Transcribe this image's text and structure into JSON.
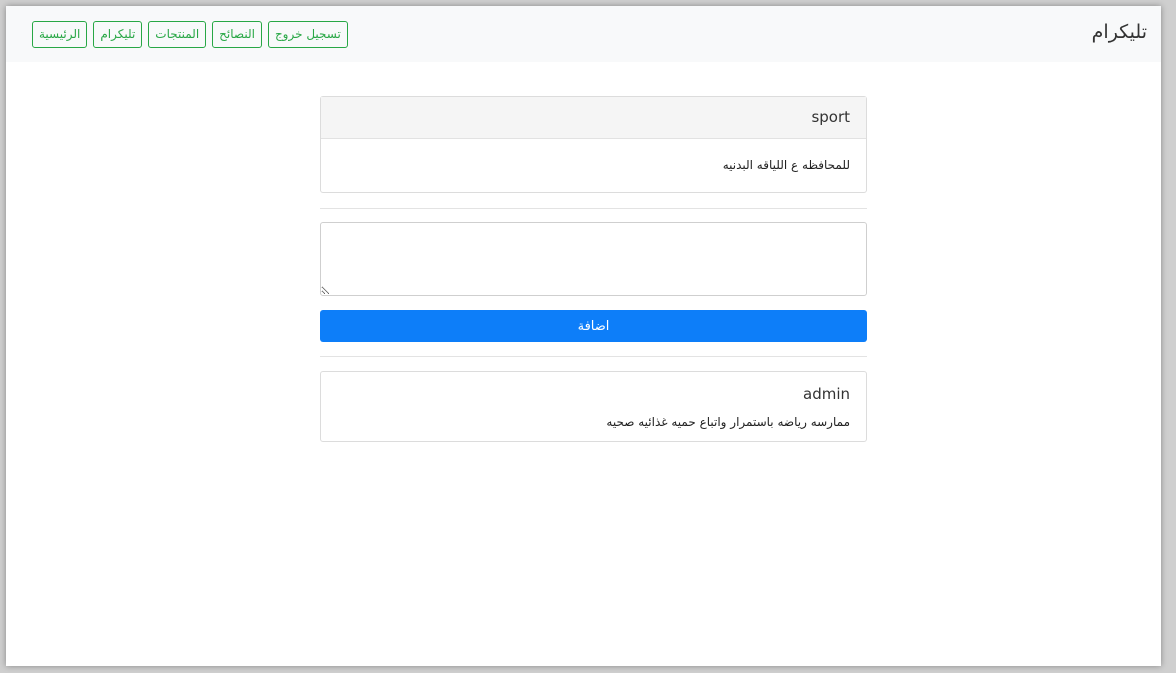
{
  "navbar": {
    "brand": "تليكرام",
    "buttons": [
      "الرئيسية",
      "تليكرام",
      "المنتجات",
      "النصائح",
      "تسجيل خروج"
    ]
  },
  "post": {
    "title": "sport",
    "body": "للمحافظه ع اللياقه البدنيه"
  },
  "form": {
    "textarea_value": "",
    "submit_label": "اضافة"
  },
  "comments": [
    {
      "author": "admin",
      "text": "ممارسه رياضه باستمرار واتباع حميه غذائيه صحيه"
    }
  ],
  "colors": {
    "nav_button": "#28a745",
    "primary": "#0d7ef9"
  }
}
